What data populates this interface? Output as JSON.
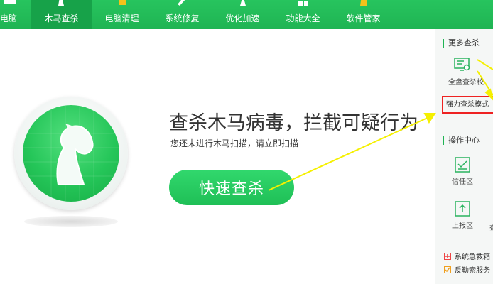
{
  "nav": {
    "items": [
      {
        "label": "电脑",
        "icon": "computer-icon",
        "active": false
      },
      {
        "label": "木马查杀",
        "icon": "horse-icon",
        "active": true
      },
      {
        "label": "电脑清理",
        "icon": "broom-icon",
        "active": false
      },
      {
        "label": "系统修复",
        "icon": "wrench-icon",
        "active": false
      },
      {
        "label": "优化加速",
        "icon": "rocket-icon",
        "active": false
      },
      {
        "label": "功能大全",
        "icon": "grid-icon",
        "active": false
      },
      {
        "label": "软件管家",
        "icon": "bag-icon",
        "active": false
      }
    ]
  },
  "main": {
    "headline": "查杀木马病毒，拦截可疑行为",
    "subline": "您还未进行木马扫描，请立即扫描",
    "quick_scan_label": "快速查杀",
    "logo_icon": "horse-shield-icon"
  },
  "right_panel": {
    "more_scan_title": "更多查杀",
    "full_scan_label": "全盘查杀",
    "custom_scan_label_partial": "校",
    "strong_mode_label": "强力查杀模式",
    "ops_title": "操作中心",
    "trust_label": "信任区",
    "report_label": "上报区",
    "links": [
      {
        "label": "系统急救箱",
        "icon": "plus-icon"
      },
      {
        "label": "反勒索服务",
        "icon": "check-icon"
      }
    ]
  },
  "colors": {
    "brand_green": "#1fb453",
    "active_tab": "#17a249",
    "highlight_red": "#e22222",
    "arrow_yellow": "#f5f000"
  }
}
